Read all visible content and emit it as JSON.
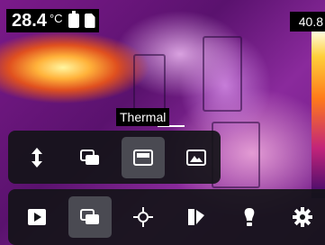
{
  "status_bar": {
    "temperature_value": "28.4",
    "temperature_unit": "°C",
    "battery_icon": "battery-icon",
    "storage_icon": "sd-card-icon"
  },
  "scale": {
    "max_value": "40.8"
  },
  "tooltip": {
    "label": "Thermal"
  },
  "image_mode_menu": {
    "buttons": [
      {
        "name": "collapse-menu",
        "icon": "up-down-arrow-icon",
        "selected": false
      },
      {
        "name": "mode-picture-in-picture",
        "icon": "picture-in-picture-icon",
        "selected": false
      },
      {
        "name": "mode-thermal",
        "icon": "thermal-mode-icon",
        "selected": true
      },
      {
        "name": "mode-digital-camera",
        "icon": "photo-icon",
        "selected": false
      }
    ]
  },
  "main_toolbar": {
    "buttons": [
      {
        "name": "play-archive",
        "icon": "play-icon",
        "selected": false
      },
      {
        "name": "image-mode",
        "icon": "image-mode-icon",
        "selected": true
      },
      {
        "name": "measurement",
        "icon": "crosshair-icon",
        "selected": false
      },
      {
        "name": "color-palette",
        "icon": "palette-icon",
        "selected": false
      },
      {
        "name": "light",
        "icon": "light-bulb-icon",
        "selected": false
      },
      {
        "name": "settings",
        "icon": "gear-icon",
        "selected": false
      }
    ]
  },
  "colors": {
    "accent_selected": "#4a4a52",
    "panel_bg": "#141418"
  }
}
